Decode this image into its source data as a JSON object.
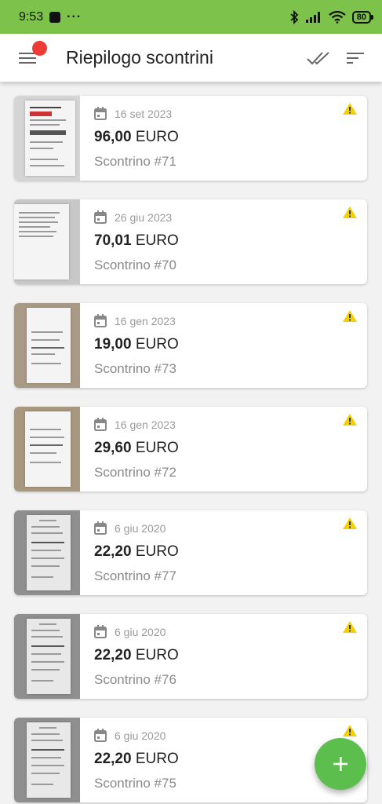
{
  "status_bar": {
    "time": "9:53",
    "dots": "···",
    "battery": "80"
  },
  "app_bar": {
    "title": "Riepilogo scontrini"
  },
  "receipts": [
    {
      "date": "16 set 2023",
      "amount_value": "96,00",
      "currency": "EURO",
      "name": "Scontrino #71"
    },
    {
      "date": "26 giu 2023",
      "amount_value": "70,01",
      "currency": "EURO",
      "name": "Scontrino #70"
    },
    {
      "date": "16 gen 2023",
      "amount_value": "19,00",
      "currency": "EURO",
      "name": "Scontrino #73"
    },
    {
      "date": "16 gen 2023",
      "amount_value": "29,60",
      "currency": "EURO",
      "name": "Scontrino #72"
    },
    {
      "date": "6 giu 2020",
      "amount_value": "22,20",
      "currency": "EURO",
      "name": "Scontrino #77"
    },
    {
      "date": "6 giu 2020",
      "amount_value": "22,20",
      "currency": "EURO",
      "name": "Scontrino #76"
    },
    {
      "date": "6 giu 2020",
      "amount_value": "22,20",
      "currency": "EURO",
      "name": "Scontrino #75"
    }
  ],
  "colors": {
    "status_bar": "#7dc24b",
    "badge": "#ef3b36",
    "warning": "#f5d000",
    "fab": "#5cbf4d"
  },
  "icons": {
    "menu": "hamburger-icon",
    "select_all": "double-check-icon",
    "sort": "sort-icon",
    "date": "calendar-icon",
    "warning": "warning-icon",
    "add": "plus-icon"
  }
}
